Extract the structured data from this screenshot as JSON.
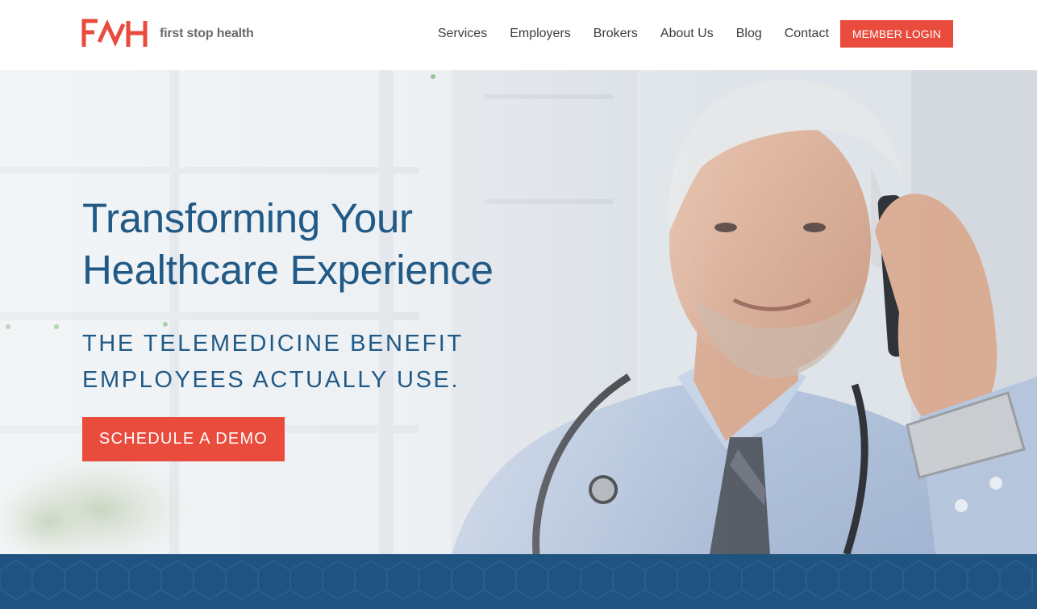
{
  "brand": {
    "name": "first stop health",
    "logo_mark": "FSH",
    "accent_color": "#e94b3c",
    "primary_color": "#215a86"
  },
  "nav": {
    "items": [
      {
        "label": "Services"
      },
      {
        "label": "Employers"
      },
      {
        "label": "Brokers"
      },
      {
        "label": "About Us"
      },
      {
        "label": "Blog"
      },
      {
        "label": "Contact"
      }
    ],
    "login_label": "MEMBER LOGIN"
  },
  "hero": {
    "title_line1": "Transforming Your",
    "title_line2": "Healthcare Experience",
    "subtitle_line1": "THE TELEMEDICINE BENEFIT",
    "subtitle_line2": "EMPLOYEES ACTUALLY USE.",
    "cta_label": "SCHEDULE A DEMO",
    "image": "doctor-on-phone-photo"
  },
  "band": {
    "color": "#1f5480"
  }
}
